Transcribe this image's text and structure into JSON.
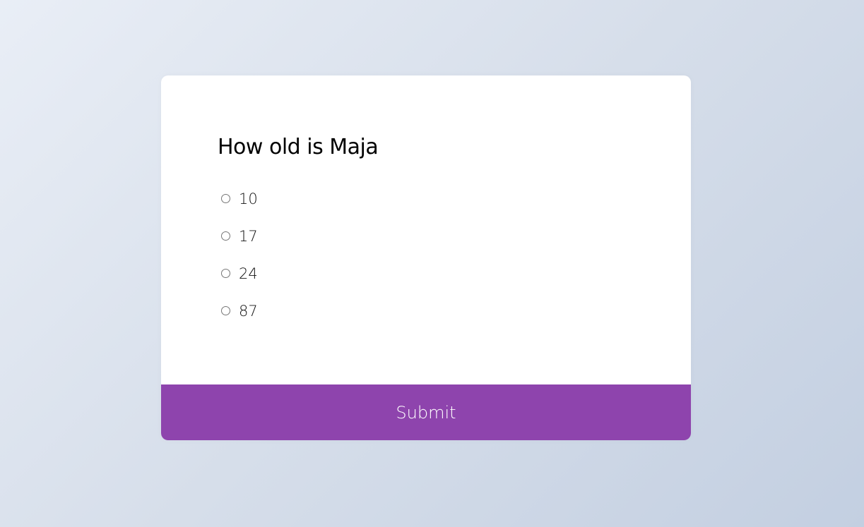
{
  "quiz": {
    "question": "How old is Maja",
    "answers": [
      {
        "label": "10",
        "selected": false
      },
      {
        "label": "17",
        "selected": false
      },
      {
        "label": "24",
        "selected": false
      },
      {
        "label": "87",
        "selected": false
      }
    ],
    "submit_label": "Submit"
  },
  "colors": {
    "accent": "#8e44ad",
    "card": "#ffffff",
    "background_start": "#e9eef6",
    "background_end": "#c3cfe1"
  }
}
